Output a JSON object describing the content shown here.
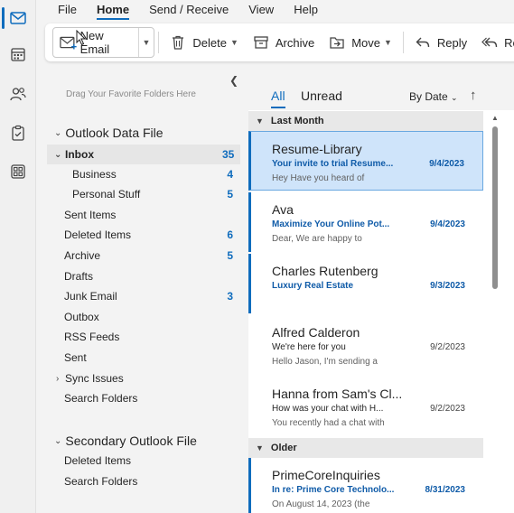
{
  "rail": {
    "items": [
      {
        "icon": "mail-icon",
        "active": true
      },
      {
        "icon": "calendar-icon",
        "active": false
      },
      {
        "icon": "people-icon",
        "active": false
      },
      {
        "icon": "tasks-icon",
        "active": false
      },
      {
        "icon": "apps-icon",
        "active": false
      }
    ]
  },
  "menu": {
    "items": [
      "File",
      "Home",
      "Send / Receive",
      "View",
      "Help"
    ],
    "active": "Home"
  },
  "ribbon": {
    "new_email": "New Email",
    "delete": "Delete",
    "archive": "Archive",
    "move": "Move",
    "reply": "Reply",
    "reply_all": "Rep"
  },
  "folders": {
    "drag_hint": "Drag Your Favorite Folders Here",
    "groups": [
      {
        "name": "Outlook Data File",
        "items": [
          {
            "label": "Inbox",
            "count": "35",
            "selected": true,
            "expandable": true,
            "indent": 0
          },
          {
            "label": "Business",
            "count": "4",
            "indent": 1
          },
          {
            "label": "Personal Stuff",
            "count": "5",
            "indent": 1
          },
          {
            "label": "Sent Items",
            "count": "",
            "indent": 0
          },
          {
            "label": "Deleted Items",
            "count": "6",
            "indent": 0
          },
          {
            "label": "Archive",
            "count": "5",
            "indent": 0
          },
          {
            "label": "Drafts",
            "count": "",
            "indent": 0
          },
          {
            "label": "Junk Email",
            "count": "3",
            "indent": 0
          },
          {
            "label": "Outbox",
            "count": "",
            "indent": 0
          },
          {
            "label": "RSS Feeds",
            "count": "",
            "indent": 0
          },
          {
            "label": "Sent",
            "count": "",
            "indent": 0
          },
          {
            "label": "Sync Issues",
            "count": "",
            "indent": 0,
            "collapsed": true
          },
          {
            "label": "Search Folders",
            "count": "",
            "indent": 0
          }
        ]
      },
      {
        "name": "Secondary Outlook File",
        "items": [
          {
            "label": "Deleted Items",
            "count": ""
          },
          {
            "label": "Search Folders",
            "count": ""
          }
        ]
      }
    ]
  },
  "message_list": {
    "tab_all": "All",
    "tab_unread": "Unread",
    "sort_label": "By Date",
    "sections": [
      {
        "label": "Last Month",
        "messages": [
          {
            "sender": "Resume-Library",
            "subject": "Your invite to trial Resume...",
            "date": "9/4/2023",
            "preview": "Hey   Have you heard of",
            "selected": true,
            "unread": true
          },
          {
            "sender": "Ava",
            "subject": "Maximize Your Online Pot...",
            "date": "9/4/2023",
            "preview": "Dear,  We are happy to",
            "unread": true
          },
          {
            "sender": "Charles Rutenberg",
            "subject": "Luxury Real Estate",
            "date": "9/3/2023",
            "preview": "",
            "unread": true
          },
          {
            "sender": "Alfred Calderon",
            "subject": "We're here for you",
            "date": "9/2/2023",
            "preview": "Hello Jason,   I'm sending a",
            "unread": false
          },
          {
            "sender": "Hanna from Sam's Cl...",
            "subject": "How was your chat with H...",
            "date": "9/2/2023",
            "preview": "You recently had a chat with",
            "unread": false
          }
        ]
      },
      {
        "label": "Older",
        "messages": [
          {
            "sender": "PrimeCoreInquiries",
            "subject": "In re: Prime Core Technolo...",
            "date": "8/31/2023",
            "preview": "On August 14, 2023 (the",
            "unread": true
          }
        ]
      }
    ]
  },
  "colors": {
    "accent": "#0f6cbd",
    "selected_bg": "#cfe4fa",
    "unread_text": "#0f5ba8"
  }
}
